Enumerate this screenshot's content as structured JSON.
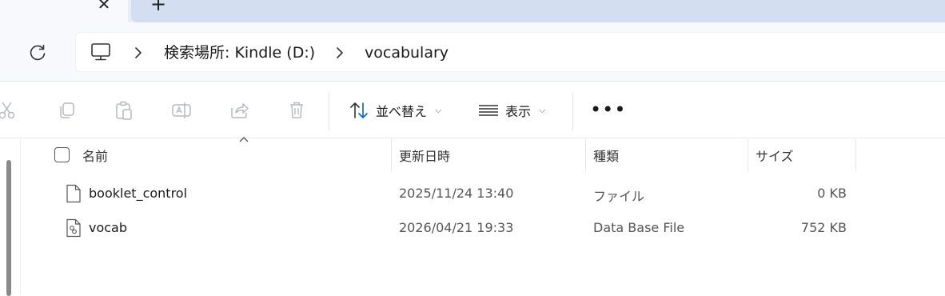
{
  "tabs": {
    "close_glyph": "✕",
    "new_glyph": "+"
  },
  "address": {
    "refresh_icon": "refresh-icon",
    "pc_icon": "computer-icon",
    "breadcrumb": [
      {
        "label": "検索場所: Kindle (D:)"
      },
      {
        "label": "vocabulary"
      }
    ]
  },
  "toolbar": {
    "icons": [
      "cut-icon",
      "copy-icon",
      "paste-icon",
      "rename-icon",
      "share-icon",
      "delete-icon"
    ],
    "sort_label": "並べ替え",
    "view_label": "表示",
    "more_label": "•••"
  },
  "file_list": {
    "columns": {
      "name": "名前",
      "date": "更新日時",
      "type": "種類",
      "size": "サイズ"
    },
    "rows": [
      {
        "name": "booklet_control",
        "date": "2025/11/24 13:40",
        "type": "ファイル",
        "size": "0 KB",
        "icon": "file-icon"
      },
      {
        "name": "vocab",
        "date": "2026/04/21 19:33",
        "type": "Data Base File",
        "size": "752 KB",
        "icon": "database-file-icon"
      }
    ]
  },
  "colors": {
    "accent": "#0067c0",
    "tabstrip": "#e9eef6",
    "address_bg": "#f7f9fc"
  }
}
